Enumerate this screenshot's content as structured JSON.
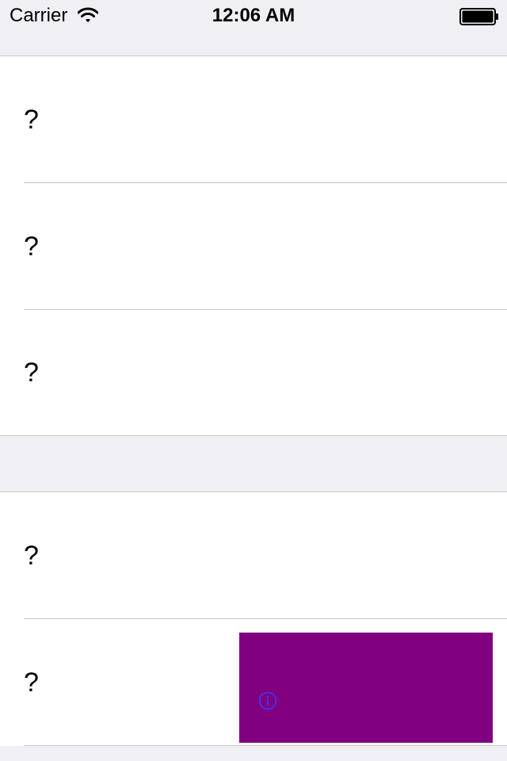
{
  "status_bar": {
    "carrier": "Carrier",
    "time": "12:06 AM",
    "wifi_icon": "wifi-icon",
    "battery_icon": "battery-icon"
  },
  "sections": [
    {
      "rows": [
        {
          "label": "?"
        },
        {
          "label": "?"
        },
        {
          "label": "?"
        }
      ]
    },
    {
      "rows": [
        {
          "label": "?"
        },
        {
          "label": "?"
        }
      ]
    }
  ],
  "ad_banner": {
    "color": "#800080",
    "info_icon": "info-icon",
    "info_color": "#3b3bff"
  },
  "colors": {
    "background": "#efeff4",
    "cell": "#ffffff",
    "separator": "#c8c7cc"
  }
}
